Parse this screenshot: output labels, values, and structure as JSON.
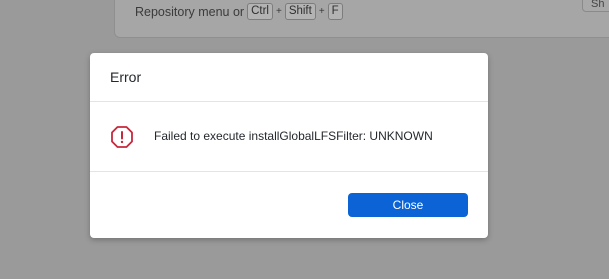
{
  "background": {
    "hint_text": "Repository menu or",
    "shortcut_keys": [
      "Ctrl",
      "Shift",
      "F"
    ],
    "plus": "+",
    "partial_button_label": "Sh"
  },
  "dialog": {
    "title": "Error",
    "message": "Failed to execute installGlobalLFSFilter: UNKNOWN",
    "icon": "error-octagon-icon",
    "close_label": "Close"
  },
  "colors": {
    "overlay": "#9a9a9a",
    "accent": "#0b63d6",
    "error": "#c8283c"
  }
}
